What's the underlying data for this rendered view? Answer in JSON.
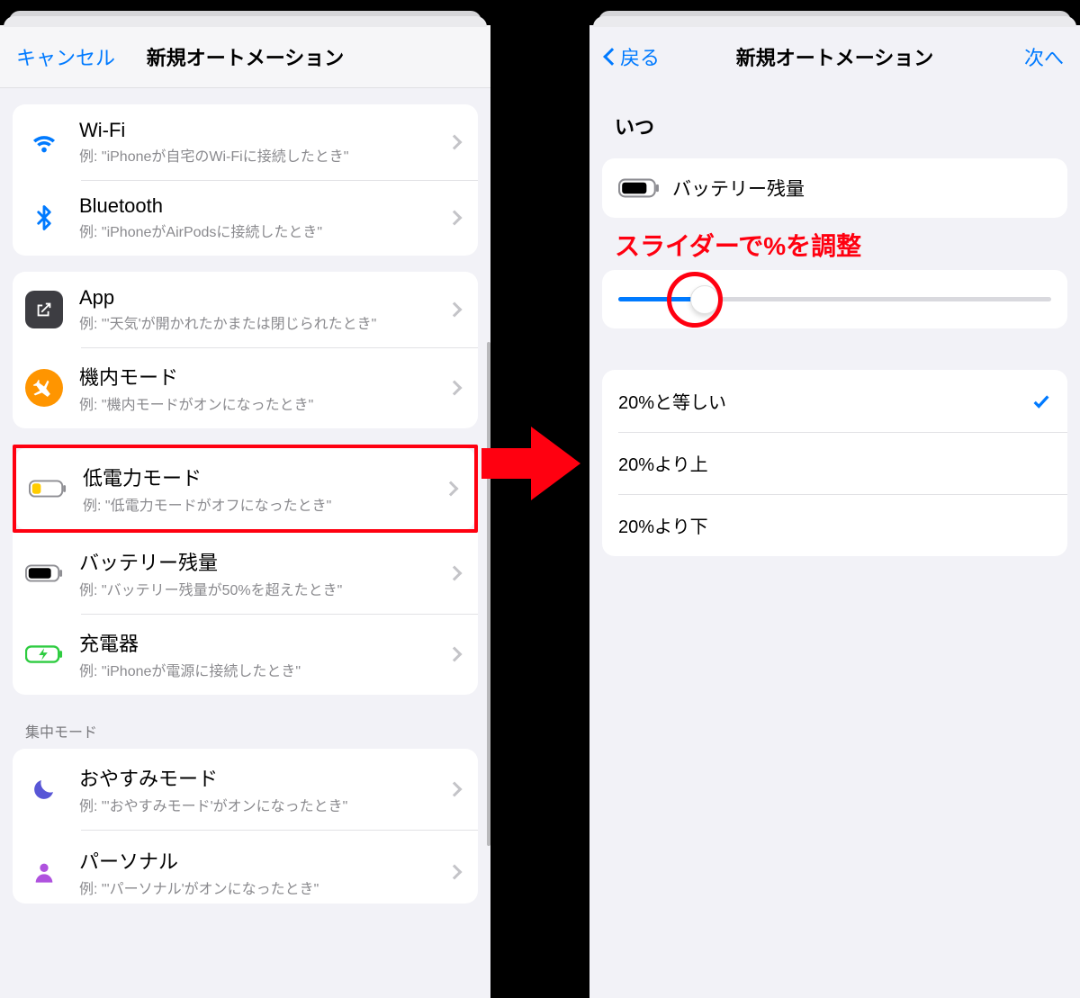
{
  "left": {
    "cancel": "キャンセル",
    "title": "新規オートメーション",
    "rows": {
      "wifi": {
        "title": "Wi-Fi",
        "sub": "例: \"iPhoneが自宅のWi-Fiに接続したとき\""
      },
      "bluetooth": {
        "title": "Bluetooth",
        "sub": "例: \"iPhoneがAirPodsに接続したとき\""
      },
      "app": {
        "title": "App",
        "sub": "例: \"'天気'が開かれたかまたは閉じられたとき\""
      },
      "airplane": {
        "title": "機内モード",
        "sub": "例: \"機内モードがオンになったとき\""
      },
      "lowpower": {
        "title": "低電力モード",
        "sub": "例: \"低電力モードがオフになったとき\""
      },
      "battery": {
        "title": "バッテリー残量",
        "sub": "例: \"バッテリー残量が50%を超えたとき\""
      },
      "charger": {
        "title": "充電器",
        "sub": "例: \"iPhoneが電源に接続したとき\""
      }
    },
    "focus_label": "集中モード",
    "focus": {
      "sleep": {
        "title": "おやすみモード",
        "sub": "例: \"'おやすみモード'がオンになったとき\""
      },
      "personal": {
        "title": "パーソナル",
        "sub": "例: \"'パーソナル'がオンになったとき\""
      }
    }
  },
  "right": {
    "back": "戻る",
    "title": "新規オートメーション",
    "next": "次へ",
    "when": "いつ",
    "battery_label": "バッテリー残量",
    "annotation": "スライダーで%を調整",
    "slider_percent": 20,
    "options": {
      "equal": "20%と等しい",
      "above": "20%より上",
      "below": "20%より下"
    }
  }
}
